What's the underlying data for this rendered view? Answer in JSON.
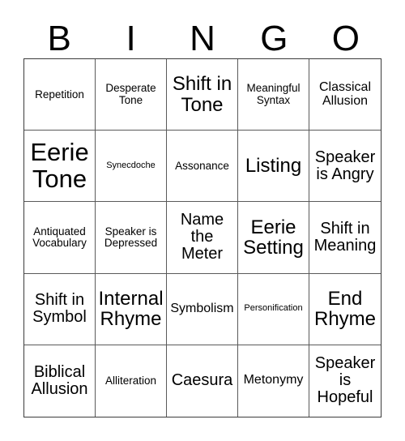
{
  "header": {
    "letters": [
      "B",
      "I",
      "N",
      "G",
      "O"
    ]
  },
  "grid": {
    "rows": 5,
    "columns": 5,
    "border_color": "#3c3c3c",
    "gridline_color": "#5a5a5a",
    "background_color": "#ffffff",
    "text_color": "#000000",
    "cells": [
      {
        "text": "Repetition",
        "size": "fs-sm"
      },
      {
        "text": "Desperate Tone",
        "size": "fs-sm"
      },
      {
        "text": "Shift in Tone",
        "size": "fs-xl"
      },
      {
        "text": "Meaningful Syntax",
        "size": "fs-sm"
      },
      {
        "text": "Classical Allusion",
        "size": "fs-md"
      },
      {
        "text": "Eerie Tone",
        "size": "fs-xxl"
      },
      {
        "text": "Synecdoche",
        "size": "fs-xs"
      },
      {
        "text": "Assonance",
        "size": "fs-sm"
      },
      {
        "text": "Listing",
        "size": "fs-xl"
      },
      {
        "text": "Speaker is Angry",
        "size": "fs-lg"
      },
      {
        "text": "Antiquated Vocabulary",
        "size": "fs-sm"
      },
      {
        "text": "Speaker is Depressed",
        "size": "fs-sm"
      },
      {
        "text": "Name the Meter",
        "size": "fs-lg"
      },
      {
        "text": "Eerie Setting",
        "size": "fs-xl"
      },
      {
        "text": "Shift in Meaning",
        "size": "fs-lg"
      },
      {
        "text": "Shift in Symbol",
        "size": "fs-lg"
      },
      {
        "text": "Internal Rhyme",
        "size": "fs-xl"
      },
      {
        "text": "Symbolism",
        "size": "fs-md"
      },
      {
        "text": "Personification",
        "size": "fs-xs"
      },
      {
        "text": "End Rhyme",
        "size": "fs-xl"
      },
      {
        "text": "Biblical Allusion",
        "size": "fs-lg"
      },
      {
        "text": "Alliteration",
        "size": "fs-sm"
      },
      {
        "text": "Caesura",
        "size": "fs-lg"
      },
      {
        "text": "Metonymy",
        "size": "fs-md"
      },
      {
        "text": "Speaker is Hopeful",
        "size": "fs-lg"
      }
    ]
  }
}
